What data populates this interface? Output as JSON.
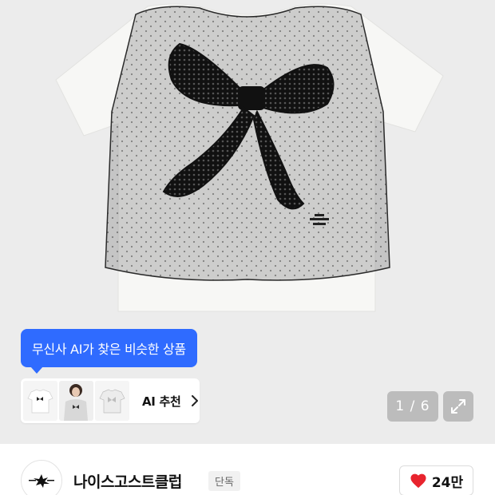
{
  "ai_recommend": {
    "bubble_text": "무신사 AI가 찾은 비슷한 상품",
    "label": "AI 추천",
    "thumbnails": [
      "white-tee-bow",
      "model-photo",
      "white-tee-mesh"
    ]
  },
  "gallery": {
    "counter": "1 / 6",
    "current_page": 1,
    "total_pages": 6
  },
  "brand": {
    "name": "나이스고스트클럽",
    "badge": "단독"
  },
  "likes": {
    "count": "24만"
  },
  "colors": {
    "accent_blue": "#2f6bff",
    "heart_red": "#e8242e"
  }
}
